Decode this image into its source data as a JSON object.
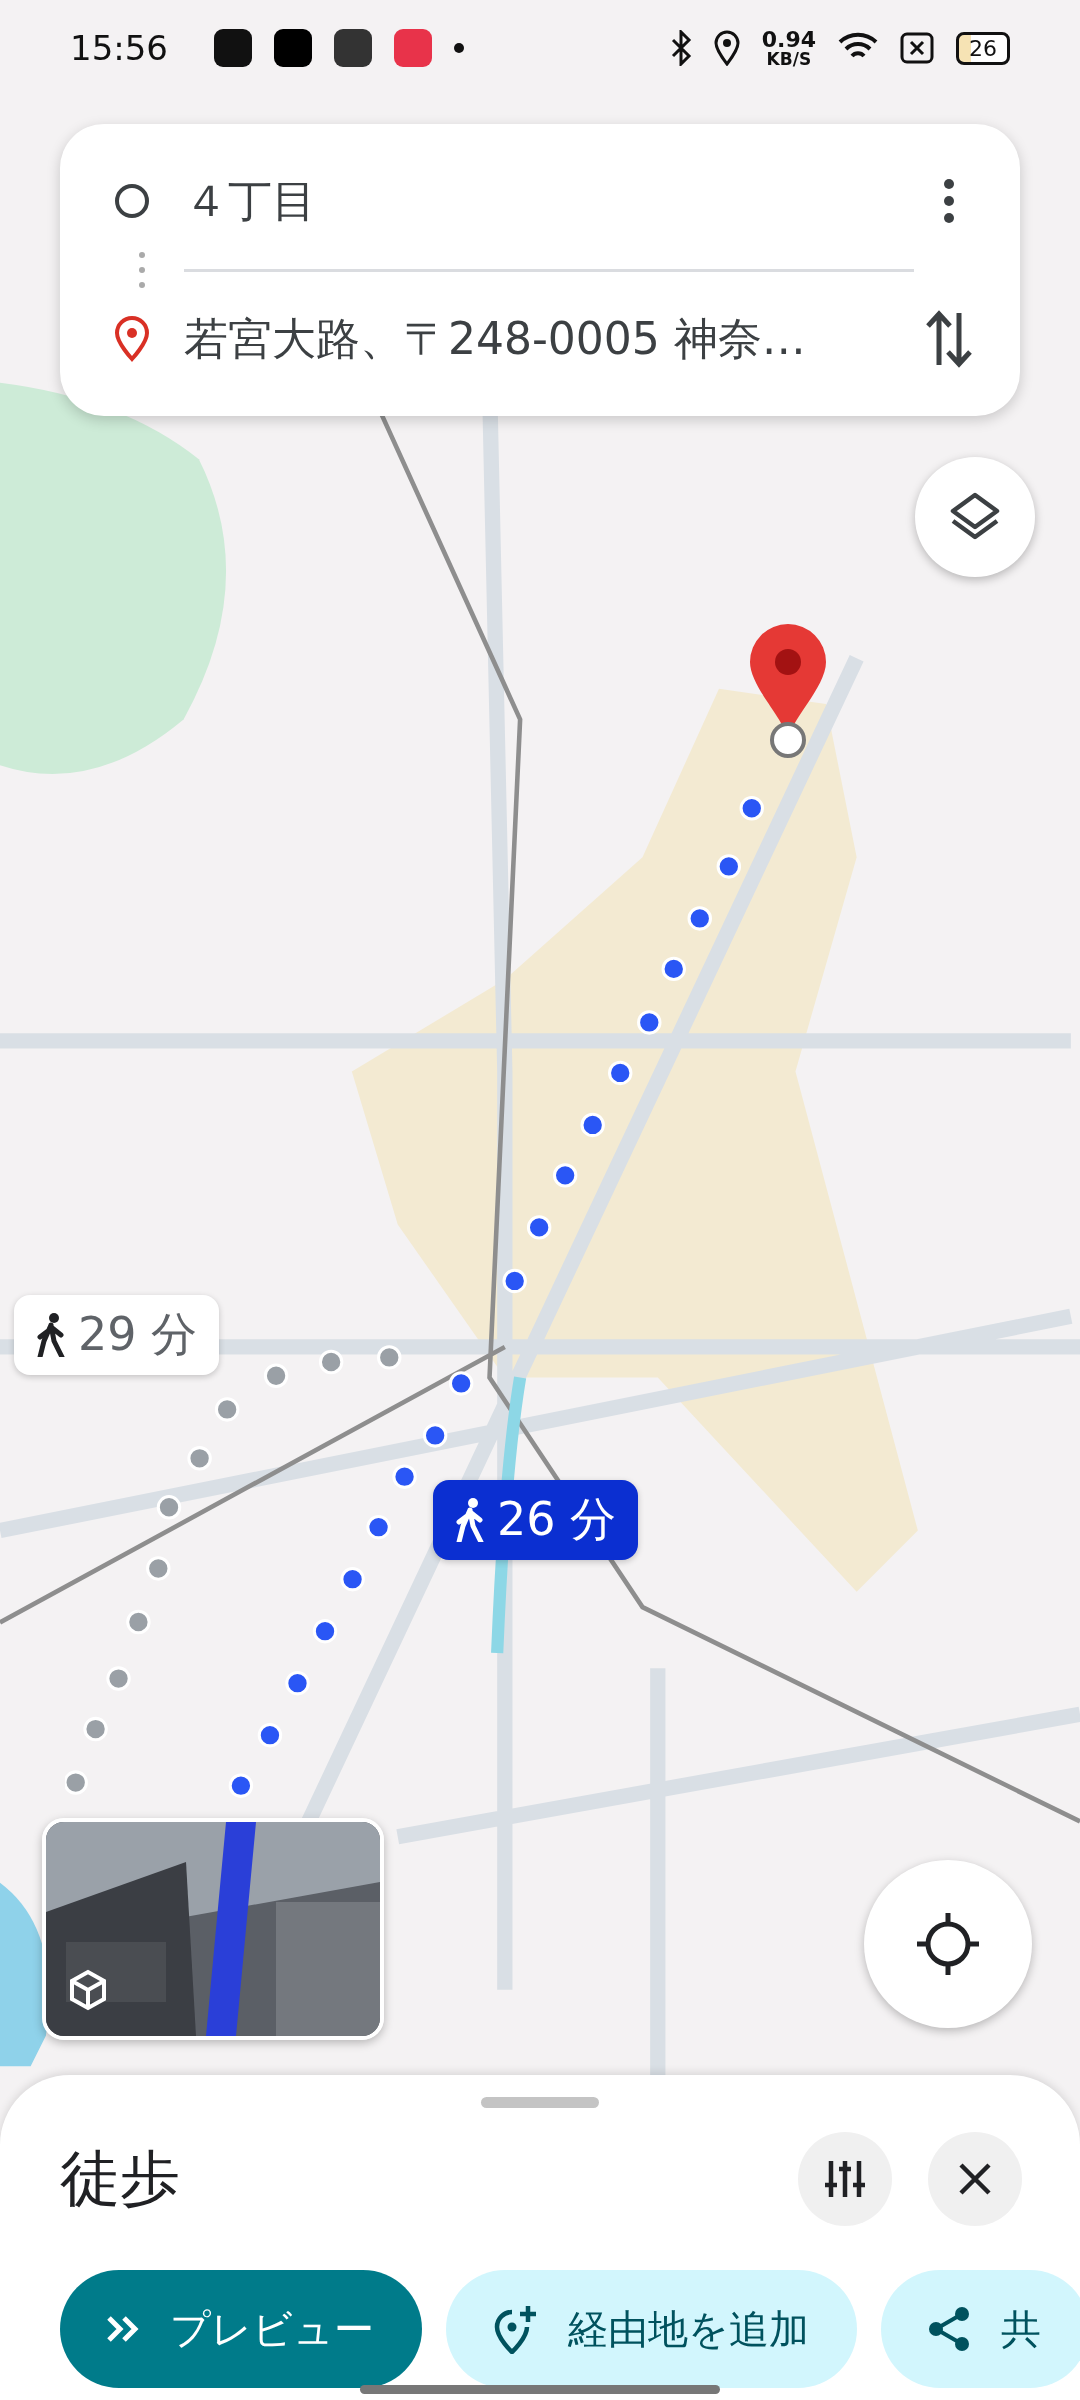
{
  "status_bar": {
    "time": "15:56",
    "network_speed": "0.94",
    "network_unit": "KB/S",
    "battery": "26"
  },
  "route_search": {
    "origin": "４丁目",
    "destination": "若宮大路、〒248-0005 神奈…"
  },
  "map": {
    "kind": "picture",
    "routes": [
      {
        "duration": "29 分",
        "selected": false
      },
      {
        "duration": "26 分",
        "selected": true
      }
    ]
  },
  "bottom_sheet": {
    "mode": "徒歩",
    "actions": [
      {
        "label": "プレビュー",
        "kind": "primary"
      },
      {
        "label": "経由地を追加",
        "kind": "waypoint"
      },
      {
        "label": "共",
        "kind": "share"
      }
    ]
  }
}
